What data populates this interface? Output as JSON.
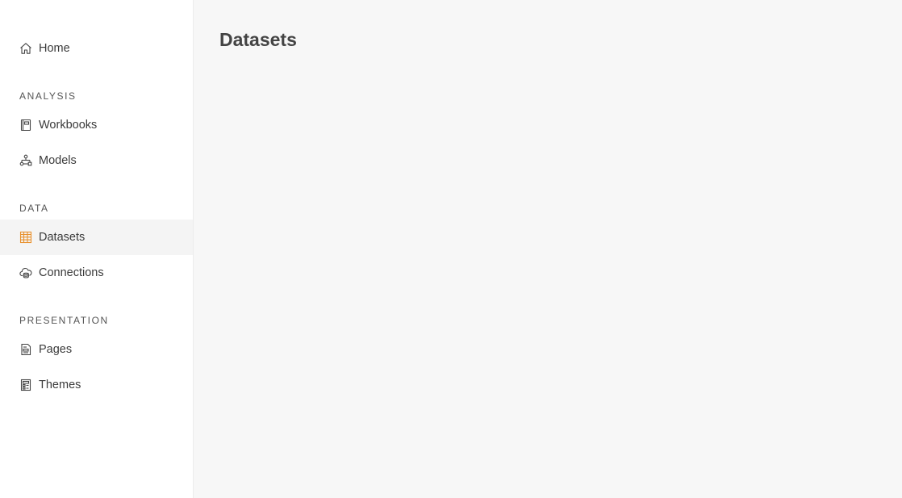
{
  "sidebar": {
    "home": {
      "label": "Home",
      "icon": "home-icon"
    },
    "sections": [
      {
        "label": "ANALYSIS",
        "items": [
          {
            "label": "Workbooks",
            "icon": "workbook-icon"
          },
          {
            "label": "Models",
            "icon": "model-icon"
          }
        ]
      },
      {
        "label": "DATA",
        "items": [
          {
            "label": "Datasets",
            "icon": "dataset-icon",
            "active": true
          },
          {
            "label": "Connections",
            "icon": "connection-icon"
          }
        ]
      },
      {
        "label": "PRESENTATION",
        "items": [
          {
            "label": "Pages",
            "icon": "page-icon"
          },
          {
            "label": "Themes",
            "icon": "theme-icon"
          }
        ]
      }
    ]
  },
  "main": {
    "title": "Datasets"
  },
  "colors": {
    "accent": "#e8912d",
    "sidebar_bg": "#ffffff",
    "main_bg": "#f7f7f7",
    "active_item_bg": "#f4f4f4"
  }
}
